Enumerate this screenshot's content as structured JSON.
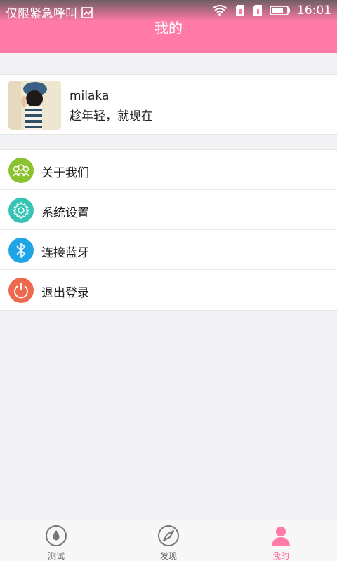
{
  "status_bar": {
    "carrier_text": "仅限紧急呼叫",
    "time": "16:01"
  },
  "header": {
    "title": "我的"
  },
  "profile": {
    "name": "milaka",
    "motto": "趁年轻，就现在"
  },
  "menu": {
    "items": [
      {
        "label": "关于我们",
        "icon": "people-group-icon",
        "color": "#8ac32e"
      },
      {
        "label": "系统设置",
        "icon": "gear-icon",
        "color": "#36c5b4"
      },
      {
        "label": "连接蓝牙",
        "icon": "bluetooth-icon",
        "color": "#1ea5e6"
      },
      {
        "label": "退出登录",
        "icon": "power-icon",
        "color": "#ee6a4e"
      }
    ]
  },
  "tabs": [
    {
      "label": "测试",
      "icon": "drop-icon",
      "active": false
    },
    {
      "label": "发现",
      "icon": "compass-icon",
      "active": false
    },
    {
      "label": "我的",
      "icon": "person-icon",
      "active": true
    }
  ],
  "colors": {
    "accent": "#ff7aa6",
    "active_tab": "#ff5f95",
    "background": "#f2f2f4"
  }
}
